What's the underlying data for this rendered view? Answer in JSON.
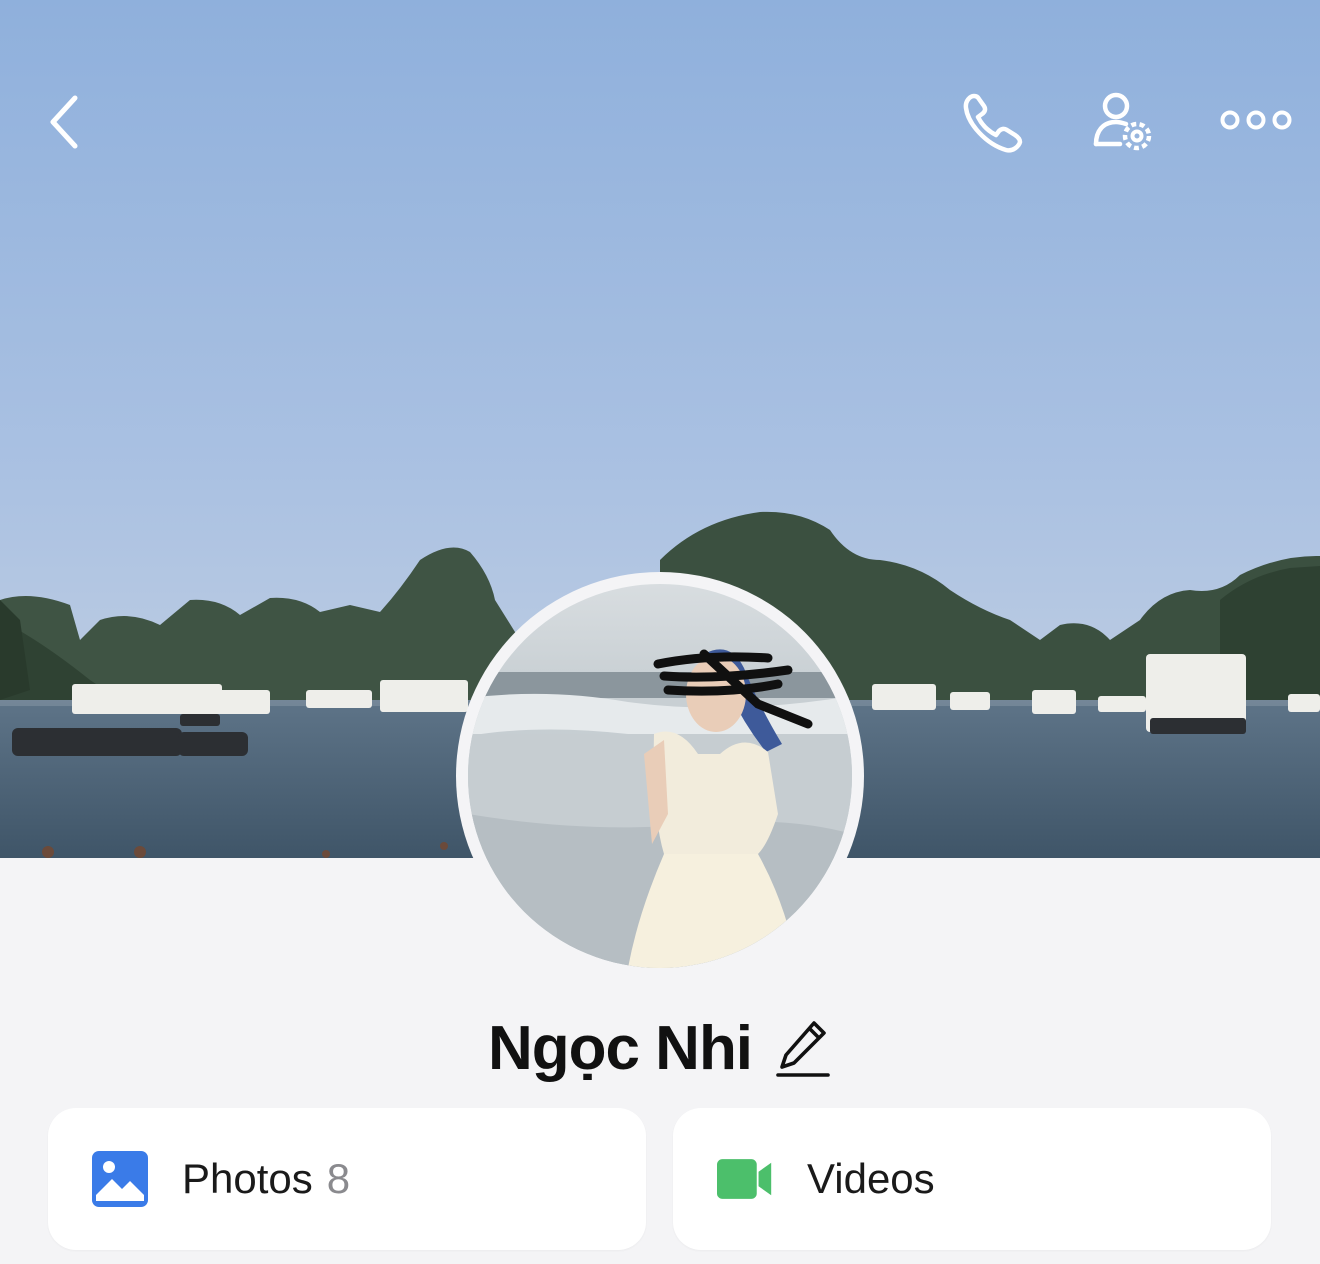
{
  "topbar": {
    "icons": [
      "chevron-left-icon",
      "phone-icon",
      "user-settings-icon",
      "more-dots-icon"
    ]
  },
  "profile": {
    "name": "Ngọc Nhi"
  },
  "media": {
    "photos": {
      "label": "Photos",
      "count": "8",
      "icon": "image-icon"
    },
    "videos": {
      "label": "Videos",
      "icon": "video-camera-icon"
    }
  },
  "colors": {
    "background": "#f4f4f6",
    "photos_icon": "#3a7be8",
    "videos_icon": "#4cbf6b",
    "count_gray": "#8a8a8e"
  }
}
